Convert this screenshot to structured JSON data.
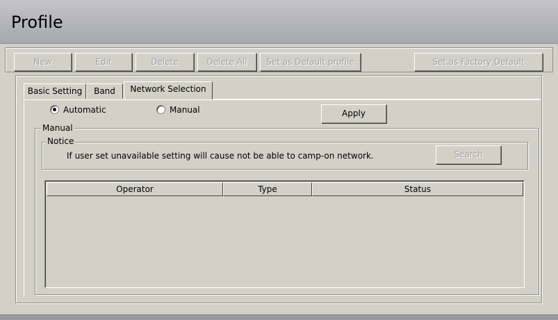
{
  "header": {
    "title": "Profile"
  },
  "toolbar": {
    "new_label": "New",
    "edit_label": "Edit",
    "delete_label": "Delete",
    "delete_all_label": "Delete All",
    "set_default_label": "Set as Default profile",
    "set_factory_label": "Set as Factory Default"
  },
  "tabs": [
    {
      "label": "Basic Setting"
    },
    {
      "label": "Band"
    },
    {
      "label": "Network Selection",
      "active": true
    }
  ],
  "mode": {
    "automatic_label": "Automatic",
    "manual_label": "Manual",
    "selected": "Automatic",
    "apply_label": "Apply"
  },
  "manual_group": {
    "legend": "Manual",
    "notice": {
      "legend": "Notice",
      "text": "If user set unavailable setting will cause  not be able to camp-on network.",
      "search_label": "Search"
    },
    "table": {
      "columns": [
        "Operator",
        "Type",
        "Status"
      ],
      "rows": []
    }
  }
}
